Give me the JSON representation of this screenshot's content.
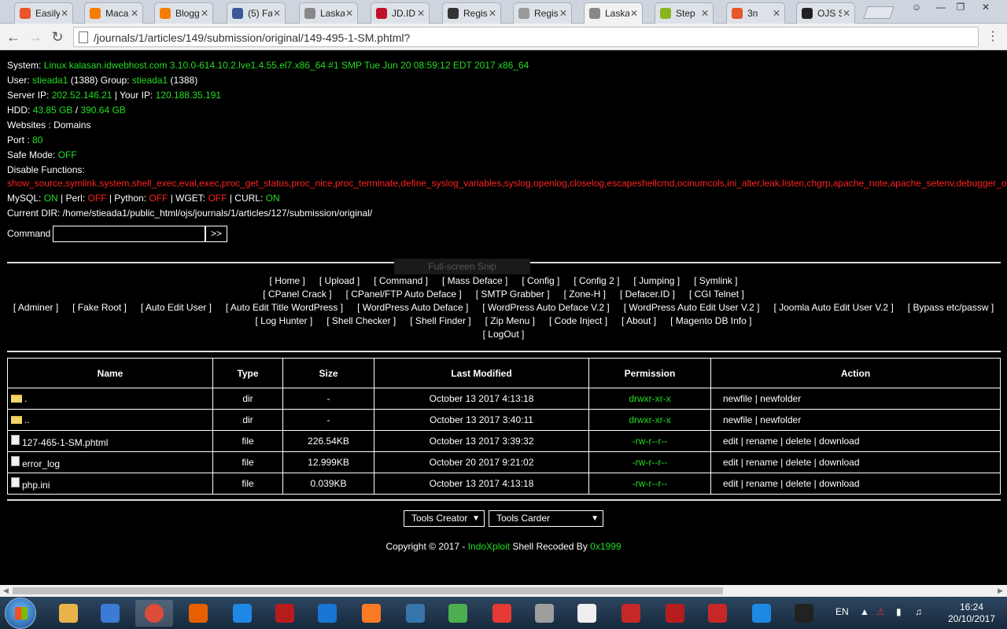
{
  "browser": {
    "tabs": [
      {
        "title": "Easily",
        "icon": "p-icon",
        "color": "#e8562a"
      },
      {
        "title": "Maca",
        "icon": "blogger-icon",
        "color": "#f57d00"
      },
      {
        "title": "Blogg",
        "icon": "blogger-icon",
        "color": "#f57d00"
      },
      {
        "title": "(5) Fa",
        "icon": "facebook-icon",
        "color": "#3b5998"
      },
      {
        "title": "Laska",
        "icon": "spiral-icon",
        "color": "#888888"
      },
      {
        "title": "JD.ID",
        "icon": "jdid-icon",
        "color": "#c0102a"
      },
      {
        "title": "Regis",
        "icon": "pkp-icon",
        "color": "#333333"
      },
      {
        "title": "Regis",
        "icon": "page-icon",
        "color": "#999999"
      },
      {
        "title": "Laska",
        "icon": "spiral-icon",
        "color": "#888888"
      },
      {
        "title": "Step",
        "icon": "step-icon",
        "color": "#8bb520"
      },
      {
        "title": "3n",
        "icon": "audio-icon",
        "color": "#e8562a"
      },
      {
        "title": "OJS S",
        "icon": "ojs-icon",
        "color": "#222222"
      }
    ],
    "url": "/journals/1/articles/149/submission/original/149-495-1-SM.phtml?"
  },
  "sysinfo": {
    "system_label": "System:",
    "system_value": "Linux kalasan.idwebhost.com 3.10.0-614.10.2.lve1.4.55.el7.x86_64 #1 SMP Tue Jun 20 08:59:12 EDT 2017 x86_64",
    "user_label": "User:",
    "user_value": "stieada1",
    "user_id": "(1388)",
    "group_label": "Group:",
    "group_value": "stieada1",
    "group_id": "(1388)",
    "server_ip_label": "Server IP:",
    "server_ip": "202.52.146.21",
    "your_ip_label": "| Your IP:",
    "your_ip": "120.188.35.191",
    "hdd_label": "HDD:",
    "hdd_used": "43.85 GB",
    "hdd_sep": "/",
    "hdd_total": "390.64 GB",
    "websites": "Websites : Domains",
    "port_label": "Port :",
    "port_value": "80",
    "safemode_label": "Safe Mode:",
    "safemode_value": "OFF",
    "disable_label": "Disable Functions:",
    "disabled_functions": "show_source,symlink,system,shell_exec,eval,exec,proc_get_status,proc_nice,proc_terminate,define_syslog_variables,syslog,openlog,closelog,escapeshellcmd,ocinumcols,ini_alter,leak,listen,chgrp,apache_note,apache_setenv,debugger_on,debugger_off,",
    "mysql_label": "MySQL:",
    "mysql": "ON",
    "perl_label": "| Perl:",
    "perl": "OFF",
    "python_label": "| Python:",
    "python": "OFF",
    "wget_label": "| WGET:",
    "wget": "OFF",
    "curl_label": "| CURL:",
    "curl": "ON",
    "current_dir": "Current DIR: /home/stieada1/public_html/ojs/journals/1/articles/127/submission/original/"
  },
  "command": {
    "label": "Command :",
    "value": "",
    "button": ">>"
  },
  "snip_overlay": "Full-screen Snip",
  "menu": {
    "row1": [
      "[ Home ]",
      "[ Upload ]",
      "[ Command ]",
      "[ Mass Deface ]",
      "[ Config ]",
      "[ Config 2 ]",
      "[ Jumping ]",
      "[ Symlink ]"
    ],
    "row2": [
      "[ CPanel Crack ]",
      "[ CPanel/FTP Auto Deface ]",
      "[ SMTP Grabber ]",
      "[ Zone-H ]",
      "[ Defacer.ID ]",
      "[ CGI Telnet ]"
    ],
    "row3": [
      "[ Adminer ]",
      "[ Fake Root ]",
      "[ Auto Edit User ]",
      "[ Auto Edit Title WordPress ]",
      "[ WordPress Auto Deface ]",
      "[ WordPress Auto Deface V.2 ]",
      "[ WordPress Auto Edit User V.2 ]",
      "[ Joomla Auto Edit User V.2 ]",
      "[ Bypass etc/passw ]"
    ],
    "row4": [
      "[ Log Hunter ]",
      "[ Shell Checker ]",
      "[ Shell Finder ]",
      "[ Zip Menu ]",
      "[ Code Inject ]",
      "[ About ]",
      "[ Magento DB Info ]"
    ],
    "row5": [
      "[ LogOut ]"
    ]
  },
  "table": {
    "headers": [
      "Name",
      "Type",
      "Size",
      "Last Modified",
      "Permission",
      "Action"
    ],
    "rows": [
      {
        "kind": "folder",
        "name": ".",
        "type": "dir",
        "size": "-",
        "modified": "October 13 2017 4:13:18",
        "perm": "drwxr-xr-x",
        "actions": [
          "newfile",
          "newfolder"
        ]
      },
      {
        "kind": "folder",
        "name": "..",
        "type": "dir",
        "size": "-",
        "modified": "October 13 2017 3:40:11",
        "perm": "drwxr-xr-x",
        "actions": [
          "newfile",
          "newfolder"
        ]
      },
      {
        "kind": "file",
        "name": "127-465-1-SM.phtml",
        "type": "file",
        "size": "226.54KB",
        "modified": "October 13 2017 3:39:32",
        "perm": "-rw-r--r--",
        "actions": [
          "edit",
          "rename",
          "delete",
          "download"
        ]
      },
      {
        "kind": "file",
        "name": "error_log",
        "type": "file",
        "size": "12.999KB",
        "modified": "October 20 2017 9:21:02",
        "perm": "-rw-r--r--",
        "actions": [
          "edit",
          "rename",
          "delete",
          "download"
        ]
      },
      {
        "kind": "file",
        "name": "php.ini",
        "type": "file",
        "size": "0.039KB",
        "modified": "October 13 2017 4:13:18",
        "perm": "-rw-r--r--",
        "actions": [
          "edit",
          "rename",
          "delete",
          "download"
        ]
      }
    ]
  },
  "tools": {
    "creator": "Tools Creator",
    "carder": "Tools Carder"
  },
  "footer": {
    "copy": "Copyright © 2017 -",
    "brand": "IndoXploit",
    "mid": "Shell Recoded By",
    "author": "0x1999"
  },
  "taskbar": {
    "icons": [
      "explorer-icon",
      "media-player-icon",
      "chrome-icon",
      "firefox-icon",
      "app-blue-icon",
      "radiation-icon",
      "shark-icon",
      "xampp-icon",
      "python-icon",
      "network-icon",
      "dots-icon",
      "robot-icon",
      "notepad-icon",
      "paint-icon",
      "filezilla-icon",
      "ruby-icon",
      "shark2-icon",
      "cmd-icon"
    ],
    "lang": "EN",
    "time": "16:24",
    "date": "20/10/2017"
  },
  "colors": {
    "green": "#22dd22",
    "red": "#ff2020",
    "bg": "#000000"
  }
}
